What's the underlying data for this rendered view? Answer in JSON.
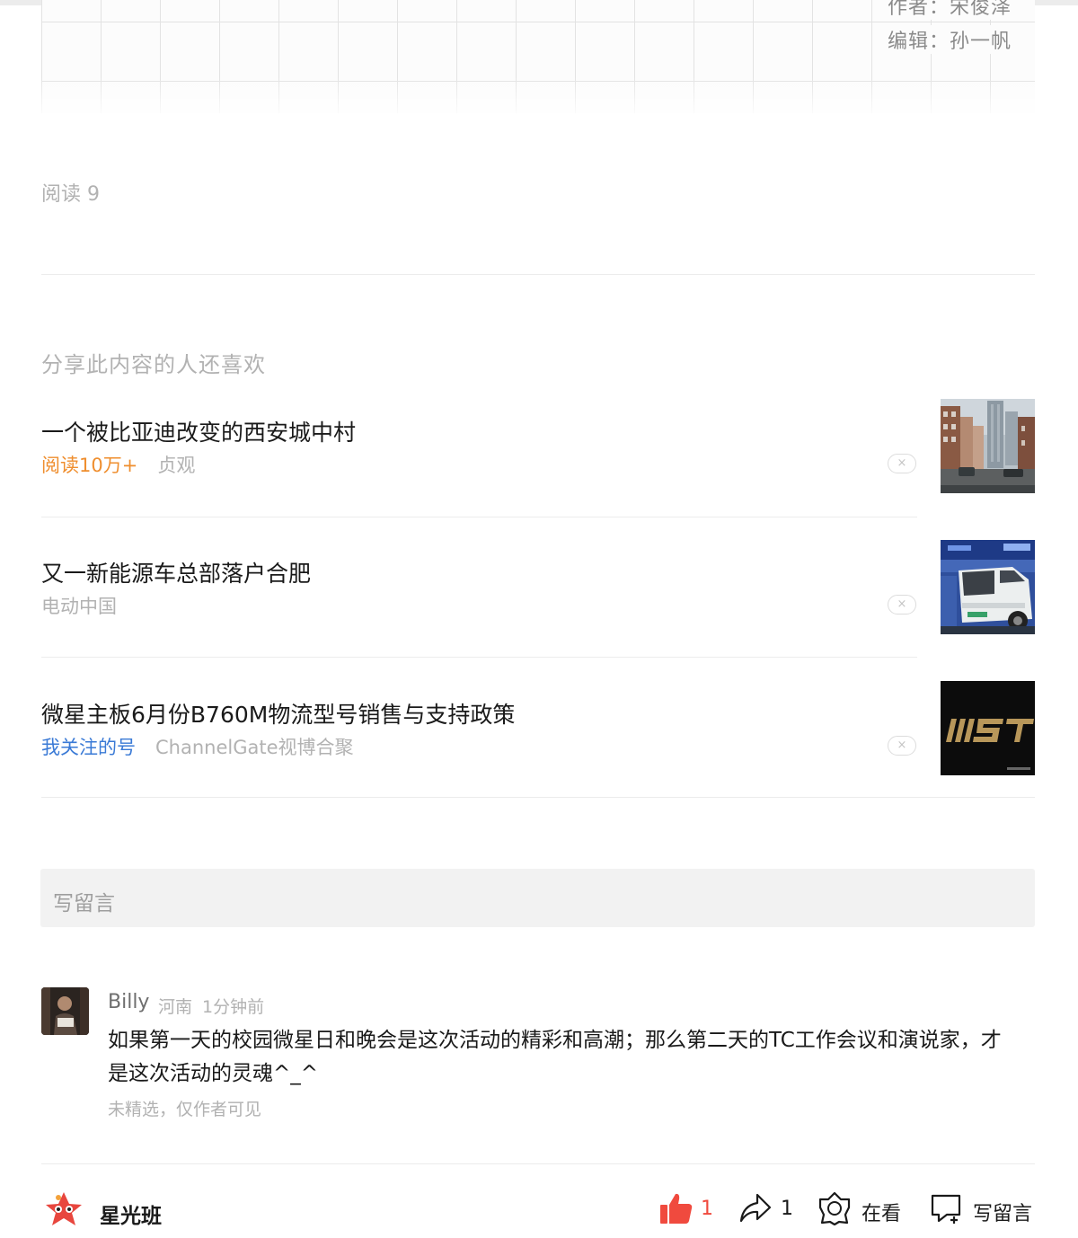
{
  "article": {
    "author_credit": "作者：宋俊泽",
    "editor_credit": "编辑：孙一帆",
    "read_count": "阅读 9"
  },
  "recommendations": {
    "title": "分享此内容的人还喜欢",
    "items": [
      {
        "title": "一个被比亚迪改变的西安城中村",
        "badge": "阅读10万+",
        "source": "贞观",
        "dismiss": "×"
      },
      {
        "title": "又一新能源车总部落户合肥",
        "source": "电动中国",
        "dismiss": "×"
      },
      {
        "title": "微星主板6月份B760M物流型号销售与支持政策",
        "badge": "我关注的号",
        "source": "ChannelGate视博合聚",
        "dismiss": "×"
      }
    ]
  },
  "comments": {
    "input_placeholder": "写留言",
    "items": [
      {
        "name": "Billy",
        "location": "河南",
        "time": "1分钟前",
        "text": "如果第一天的校园微星日和晚会是这次活动的精彩和高潮；那么第二天的TC工作会议和演说家，才是这次活动的灵魂^_^",
        "note": "未精选，仅作者可见"
      }
    ]
  },
  "bottom_bar": {
    "account_name": "星光班",
    "like_count": "1",
    "share_count": "1",
    "wow_label": "在看",
    "comment_label": "写留言"
  },
  "colors": {
    "accent_orange": "#ef8e2e",
    "accent_blue": "#3a7ad6",
    "like_red": "#f04a3e",
    "muted_text": "#b2b2b2"
  }
}
